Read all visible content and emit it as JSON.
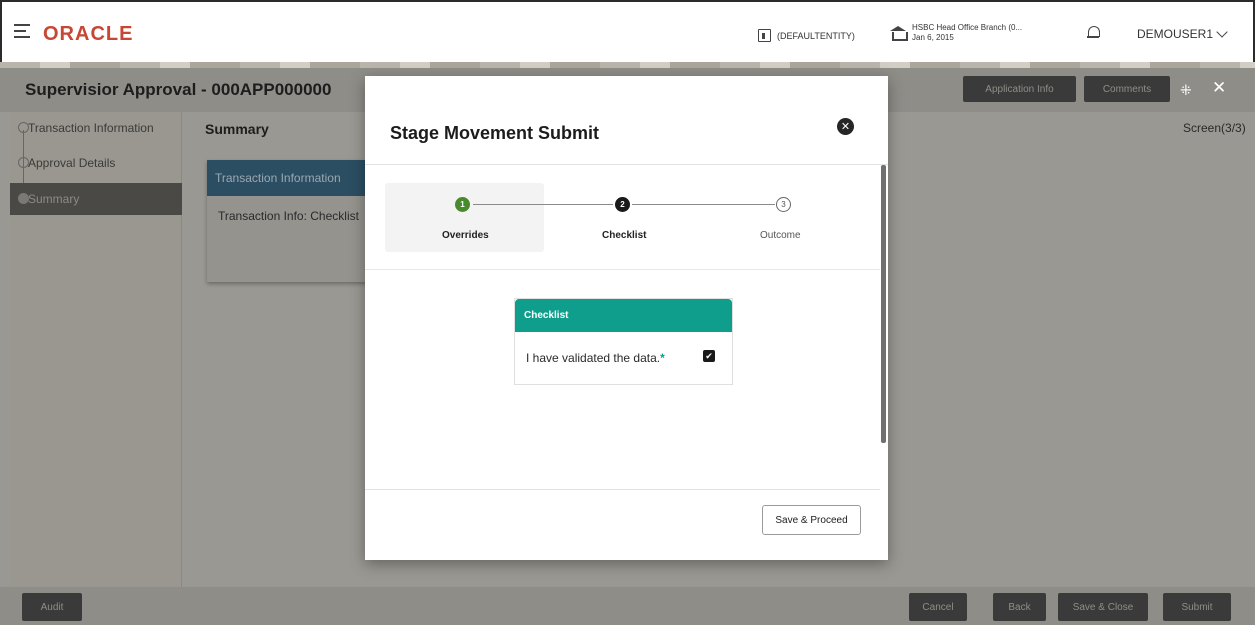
{
  "header": {
    "logo": "ORACLE",
    "entity": "(DEFAULTENTITY)",
    "branch_name": "HSBC Head Office Branch (0...",
    "branch_date": "Jan 6, 2015",
    "user": "DEMOUSER1"
  },
  "page": {
    "title": "Supervisior Approval - 000APP000000",
    "application_info": "Application Info",
    "comments": "Comments",
    "screen_count": "Screen(3/3)"
  },
  "sidebar": {
    "items": [
      {
        "label": "Transaction Information"
      },
      {
        "label": "Approval Details"
      },
      {
        "label": "Summary"
      }
    ]
  },
  "summary": {
    "title": "Summary",
    "card_title": "Transaction Information",
    "card_body": "Transaction Info: Checklist"
  },
  "footer": {
    "audit": "Audit",
    "cancel": "Cancel",
    "back": "Back",
    "save_close": "Save & Close",
    "submit": "Submit"
  },
  "modal": {
    "title": "Stage Movement Submit",
    "steps": [
      {
        "number": "1",
        "label": "Overrides"
      },
      {
        "number": "2",
        "label": "Checklist"
      },
      {
        "number": "3",
        "label": "Outcome"
      }
    ],
    "checklist_title": "Checklist",
    "checklist_item": "I have validated the data.",
    "required_mark": "*",
    "save_proceed": "Save & Proceed"
  },
  "colors": {
    "oracle_red": "#c74634",
    "teal": "#0f9e8c",
    "step1_green": "#4a8a2e",
    "dark": "#262626"
  },
  "icons": {
    "menu": "hamburger-icon",
    "entity": "entity-icon",
    "branch": "bank-icon",
    "notifications": "bell-icon",
    "user_dropdown": "chevron-down-icon",
    "collapse": "collapse-icon",
    "close": "close-icon",
    "modal_close": "close-circle-icon",
    "checkbox": "checkbox-checked-icon"
  }
}
